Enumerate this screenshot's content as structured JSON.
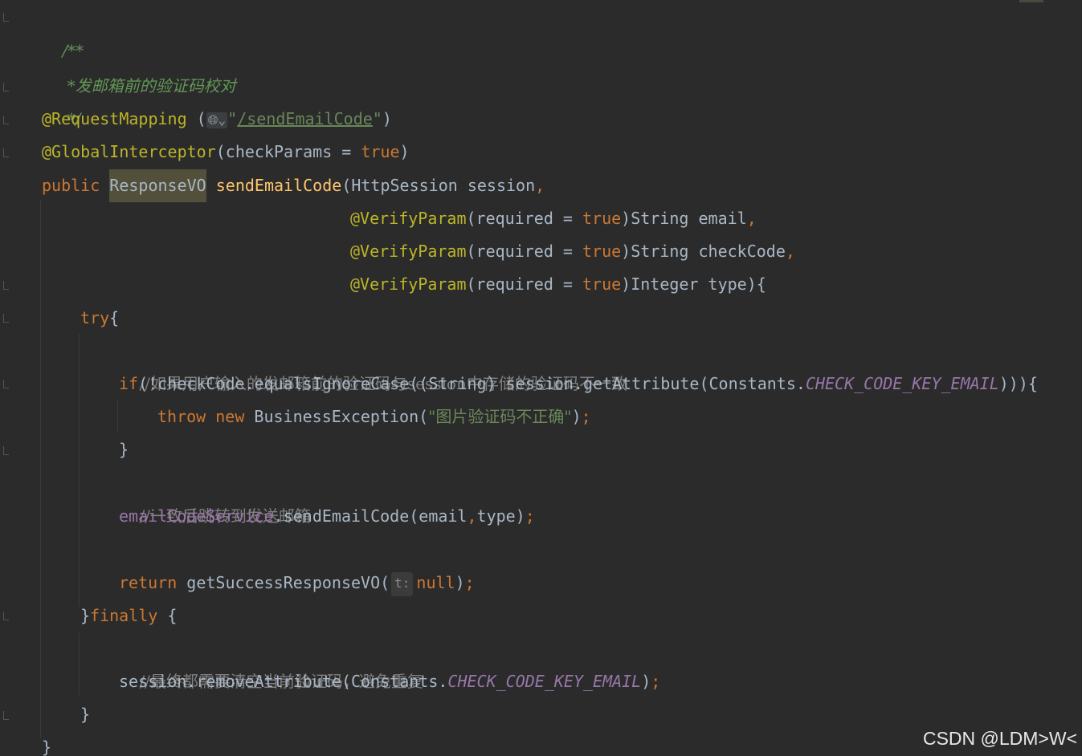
{
  "code": {
    "doc_open": "/**",
    "doc_body": " *发邮箱前的验证码校对",
    "doc_close": " */",
    "annot_mapping": "@RequestMapping",
    "mapping_paren_open": " (",
    "globe_icon": "globe-icon",
    "globe_glyph": "🌐︎⌄",
    "quote": "\"",
    "url": "/sendEmailCode",
    "mapping_paren_close": ")",
    "annot_interceptor": "@GlobalInterceptor",
    "interceptor_args_open": "(checkParams = ",
    "kw_true": "true",
    "close_paren": ")",
    "kw_public": "public",
    "space": " ",
    "type_responsevo": "ResponseVO",
    "method_send": "sendEmailCode",
    "params_first": "(HttpSession session",
    "comma": ",",
    "annot_verify": "@VerifyParam",
    "verify_open": "(required = ",
    "param_email": ")String email",
    "param_checkcode": ")String checkCode",
    "param_type": ")Integer type){",
    "kw_try": "try",
    "brace_open": "{",
    "comment_compare": "//如果用户输入的发邮箱前的验证码与session中存储的验证码不一致",
    "kw_if": "if",
    "if_cond": "(!checkCode.equalsIgnoreCase((String) session.getAttribute(Constants.",
    "const_key": "CHECK_CODE_KEY_EMAIL",
    "if_close": "))){",
    "kw_throw": "throw",
    "kw_new": "new",
    "throw_class": " BusinessException(",
    "throw_msg": "\"图片验证码不正确\"",
    "semicolon": ";",
    "brace_close": "}",
    "comment_send": "//一致后跳转到发送邮箱",
    "field_service": "emailCodeService",
    "service_call": ".sendEmailCode(email",
    "service_args_end": "type)",
    "kw_return": "return",
    "return_call": " getSuccessResponseVO(",
    "hint_t": "t:",
    "kw_null": "null",
    "finally_brace": "}",
    "kw_finally": "finally",
    "finally_open": " {",
    "comment_final": "//最终都需要清空当前验证码，避免重复",
    "remove_call": "session.removeAttribute(Constants.",
    "remove_close": ")"
  },
  "watermark": "CSDN @LDM>W<",
  "colors": {
    "background": "#2b2b2b",
    "keyword": "#cc7832",
    "annotation": "#bbb529",
    "string": "#6a8759",
    "method": "#ffc66d",
    "field": "#9876aa",
    "doc_comment": "#629755",
    "line_comment": "#808080",
    "text": "#a9b7c6"
  }
}
